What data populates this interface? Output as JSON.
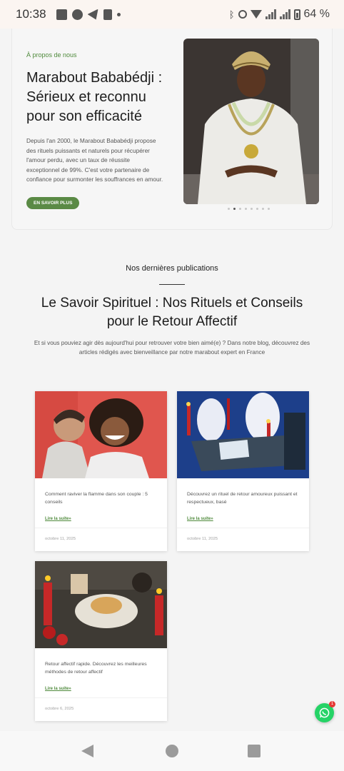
{
  "status_bar": {
    "time": "10:38",
    "battery": "64 %"
  },
  "hero": {
    "eyebrow": "À propos de nous",
    "title": "Marabout Bababédji : Sérieux et reconnu pour son efficacité",
    "description": "Depuis l'an 2000, le Marabout Bababédji propose des rituels puissants et naturels pour récupérer l'amour perdu, avec un taux de réussite exceptionnel de 99%. C'est votre partenaire de confiance pour surmonter les souffrances en amour.",
    "button_label": "EN SAVOIR PLUS",
    "slider": {
      "total": 8,
      "active_index": 1
    }
  },
  "section": {
    "kicker": "Nos dernières publications",
    "title": "Le Savoir Spirituel : Nos Rituels et Conseils pour le Retour Affectif",
    "subtitle": "Et si vous pouviez agir dès aujourd'hui pour retrouver votre bien aimé(e) ? Dans notre blog, découvrez des articles rédigés avec bienveillance par notre marabout expert en France"
  },
  "posts": [
    {
      "excerpt": "Comment raviver la flamme dans son couple : 5 conseils",
      "link_label": "Lire la suite»",
      "date": "octobre 11, 2025"
    },
    {
      "excerpt": "Découvrez un rituel de retour amoureux puissant et respectueux, basé",
      "link_label": "Lire la suite»",
      "date": "octobre 11, 2025"
    },
    {
      "excerpt": "Retour affectif rapide. Découvrez les meilleures méthodes de retour affectif",
      "link_label": "Lire la suite»",
      "date": "octobre 6, 2025"
    }
  ],
  "floating": {
    "badge": "1"
  },
  "colors": {
    "accent": "#5a8a45",
    "whatsapp": "#25d366"
  }
}
